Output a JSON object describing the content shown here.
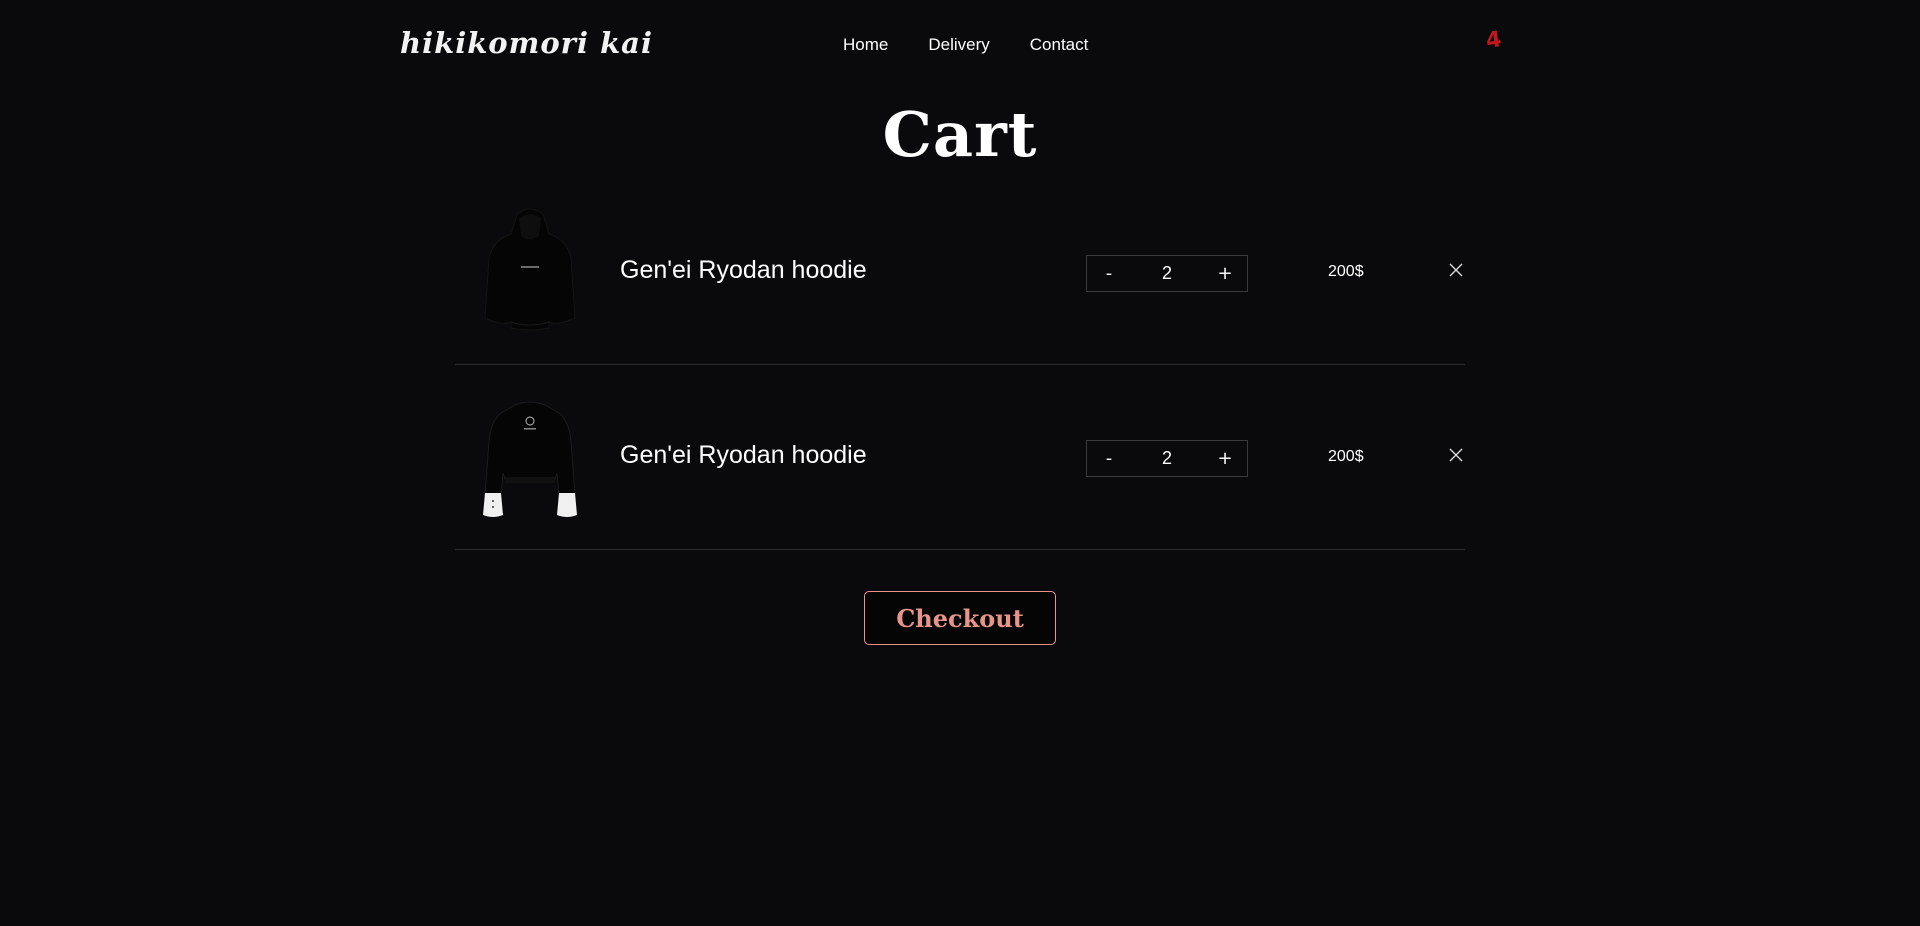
{
  "header": {
    "logo": "hikikomori kai",
    "nav": [
      "Home",
      "Delivery",
      "Contact"
    ],
    "cart_icon": "4"
  },
  "page": {
    "title": "Cart"
  },
  "cart": {
    "items": [
      {
        "name": "Gen'ei Ryodan hoodie",
        "quantity": "2",
        "decrement": "-",
        "increment": "+",
        "price": "200$",
        "image_icon": "black-hoodie-image"
      },
      {
        "name": "Gen'ei Ryodan hoodie",
        "quantity": "2",
        "decrement": "-",
        "increment": "+",
        "price": "200$",
        "image_icon": "black-white-sleeve-sweater-image"
      }
    ],
    "remove_icon": "close-icon"
  },
  "checkout": {
    "label": "Checkout"
  },
  "colors": {
    "background": "#0a0a0c",
    "accent": "#e8948a",
    "cart_icon": "#c4161c",
    "divider": "#2b2b2e"
  }
}
